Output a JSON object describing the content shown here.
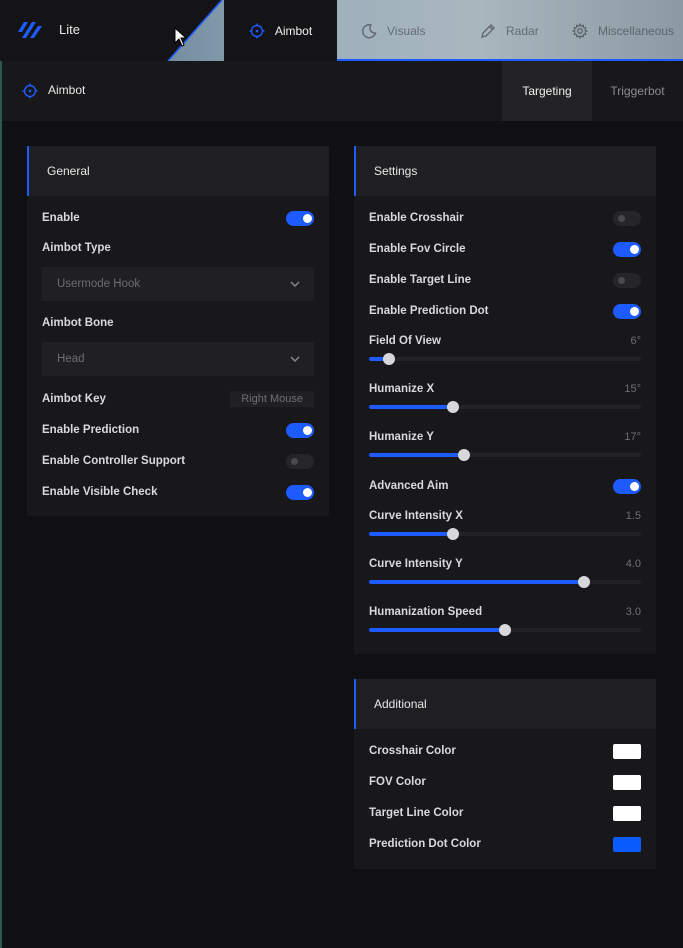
{
  "colors": {
    "accent": "#1e5bff",
    "swatch_white": "#ffffff",
    "swatch_blue": "#0a5cff"
  },
  "brand": {
    "name": "Lite",
    "logo_icon": "slash-logo-icon"
  },
  "nav": {
    "tabs": [
      {
        "label": "Aimbot",
        "icon": "crosshair-icon",
        "active": true
      },
      {
        "label": "Visuals",
        "icon": "moon-icon",
        "active": false
      },
      {
        "label": "Radar",
        "icon": "pen-icon",
        "active": false
      },
      {
        "label": "Miscellaneous",
        "icon": "gear-icon",
        "active": false
      }
    ]
  },
  "subheader": {
    "title": "Aimbot",
    "icon": "crosshair-icon",
    "tabs": [
      {
        "label": "Targeting",
        "active": true
      },
      {
        "label": "Triggerbot",
        "active": false
      }
    ]
  },
  "general": {
    "title": "General",
    "enable": {
      "label": "Enable",
      "on": true
    },
    "aimbot_type": {
      "label": "Aimbot Type",
      "value": "Usermode Hook"
    },
    "aimbot_bone": {
      "label": "Aimbot Bone",
      "value": "Head"
    },
    "aimbot_key": {
      "label": "Aimbot Key",
      "value": "Right Mouse"
    },
    "enable_prediction": {
      "label": "Enable Prediction",
      "on": true
    },
    "controller_support": {
      "label": "Enable Controller Support",
      "on": false
    },
    "visible_check": {
      "label": "Enable Visible Check",
      "on": true
    }
  },
  "settings": {
    "title": "Settings",
    "enable_crosshair": {
      "label": "Enable Crosshair",
      "on": false
    },
    "enable_fov_circle": {
      "label": "Enable Fov Circle",
      "on": true
    },
    "enable_target_line": {
      "label": "Enable Target Line",
      "on": false
    },
    "enable_prediction_dot": {
      "label": "Enable Prediction Dot",
      "on": true
    },
    "field_of_view": {
      "label": "Field Of View",
      "value": "6°",
      "fraction": 0.075
    },
    "humanize_x": {
      "label": "Humanize X",
      "value": "15°",
      "fraction": 0.31
    },
    "humanize_y": {
      "label": "Humanize Y",
      "value": "17°",
      "fraction": 0.35
    },
    "advanced_aim": {
      "label": "Advanced Aim",
      "on": true
    },
    "curve_intensity_x": {
      "label": "Curve Intensity X",
      "value": "1.5",
      "fraction": 0.31
    },
    "curve_intensity_y": {
      "label": "Curve Intensity Y",
      "value": "4.0",
      "fraction": 0.79
    },
    "humanization_speed": {
      "label": "Humanization Speed",
      "value": "3.0",
      "fraction": 0.5
    }
  },
  "additional": {
    "title": "Additional",
    "crosshair_color": {
      "label": "Crosshair Color",
      "color": "#ffffff"
    },
    "fov_color": {
      "label": "FOV Color",
      "color": "#ffffff"
    },
    "target_line_color": {
      "label": "Target Line Color",
      "color": "#ffffff"
    },
    "prediction_dot_color": {
      "label": "Prediction Dot Color",
      "color": "#0a5cff"
    }
  }
}
